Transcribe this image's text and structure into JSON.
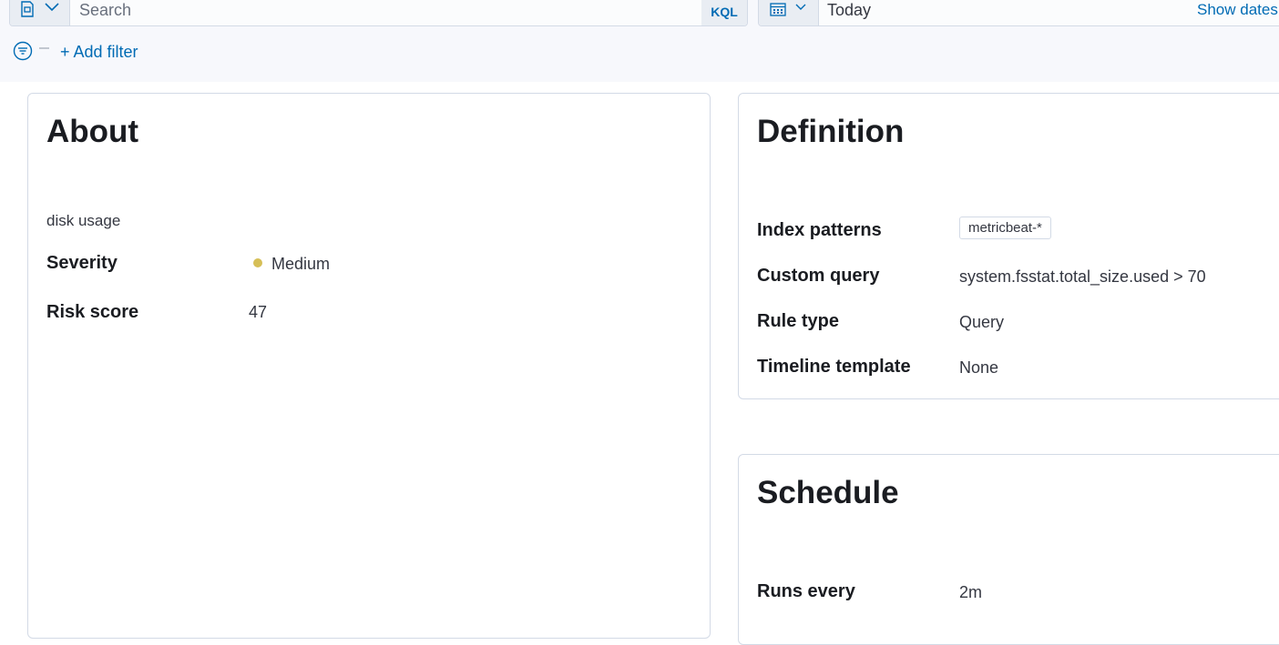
{
  "query_bar": {
    "search_placeholder": "Search",
    "language_label": "KQL",
    "date_value": "Today",
    "show_dates_label": "Show dates"
  },
  "filters": {
    "add_filter_label": "+ Add filter"
  },
  "about": {
    "title": "About",
    "description": "disk usage",
    "severity_label": "Severity",
    "severity_value": "Medium",
    "severity_color": "#d6bf57",
    "risk_score_label": "Risk score",
    "risk_score_value": "47"
  },
  "definition": {
    "title": "Definition",
    "index_patterns_label": "Index patterns",
    "index_patterns_value": "metricbeat-*",
    "custom_query_label": "Custom query",
    "custom_query_value": "system.fsstat.total_size.used > 70",
    "rule_type_label": "Rule type",
    "rule_type_value": "Query",
    "timeline_template_label": "Timeline template",
    "timeline_template_value": "None"
  },
  "schedule": {
    "title": "Schedule",
    "runs_every_label": "Runs every",
    "runs_every_value": "2m"
  },
  "colors": {
    "accent": "#006bb4",
    "topbar_bg": "#f7f8fc",
    "border": "#d3dae6"
  },
  "icons": {
    "saved_query": "saved-query-icon",
    "calendar": "calendar-icon",
    "filter": "filter-icon"
  }
}
